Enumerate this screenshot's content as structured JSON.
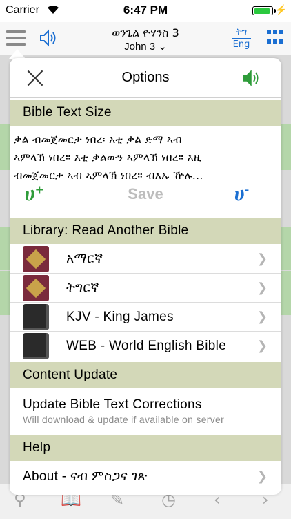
{
  "status": {
    "carrier": "Carrier",
    "time": "6:47 PM",
    "battery_level": 0.9
  },
  "nav": {
    "title": "ወንጌል ዮሃንስ 3",
    "subtitle": "John 3 ⌄",
    "lang_top": "ትግ",
    "lang_bottom": "Eng"
  },
  "options": {
    "title": "Options",
    "sections": {
      "text_size": "Bible Text Size",
      "library": "Library: Read Another Bible",
      "content_update": "Content Update",
      "help": "Help"
    },
    "sample_text": [
      "ቃል ብመጀመርታ ነበረ፡ እቲ ቃል ድማ ኣብ",
      "ኣምላኽ ነበረ። እቲ ቃልውን ኣምላኽ ነበረ። እዚ",
      "ብመጀመርታ ኣብ ኣምላኽ ነበረ። ብእኡ ዅሉ..."
    ],
    "size_increase": "ሀ",
    "size_increase_sign": "+",
    "save_label": "Save",
    "size_decrease": "ሀ",
    "size_decrease_sign": "-",
    "library_items": [
      {
        "label": "አማርኛ",
        "icon": "cross-icon"
      },
      {
        "label": "ትግርኛ",
        "icon": "cross-icon"
      },
      {
        "label": "KJV - King James",
        "icon": "book-icon"
      },
      {
        "label": "WEB - World English Bible",
        "icon": "book-icon"
      }
    ],
    "update_title": "Update Bible Text Corrections",
    "update_subtitle": "Will download & update if available on server",
    "about_label": "About - ናብ ምስጋና ገጽ"
  },
  "colors": {
    "accent_blue": "#1b6fd2",
    "accent_green": "#2f9c3a",
    "section_header_bg": "#d3d8b8",
    "highlight_green": "#b4d6a9"
  }
}
